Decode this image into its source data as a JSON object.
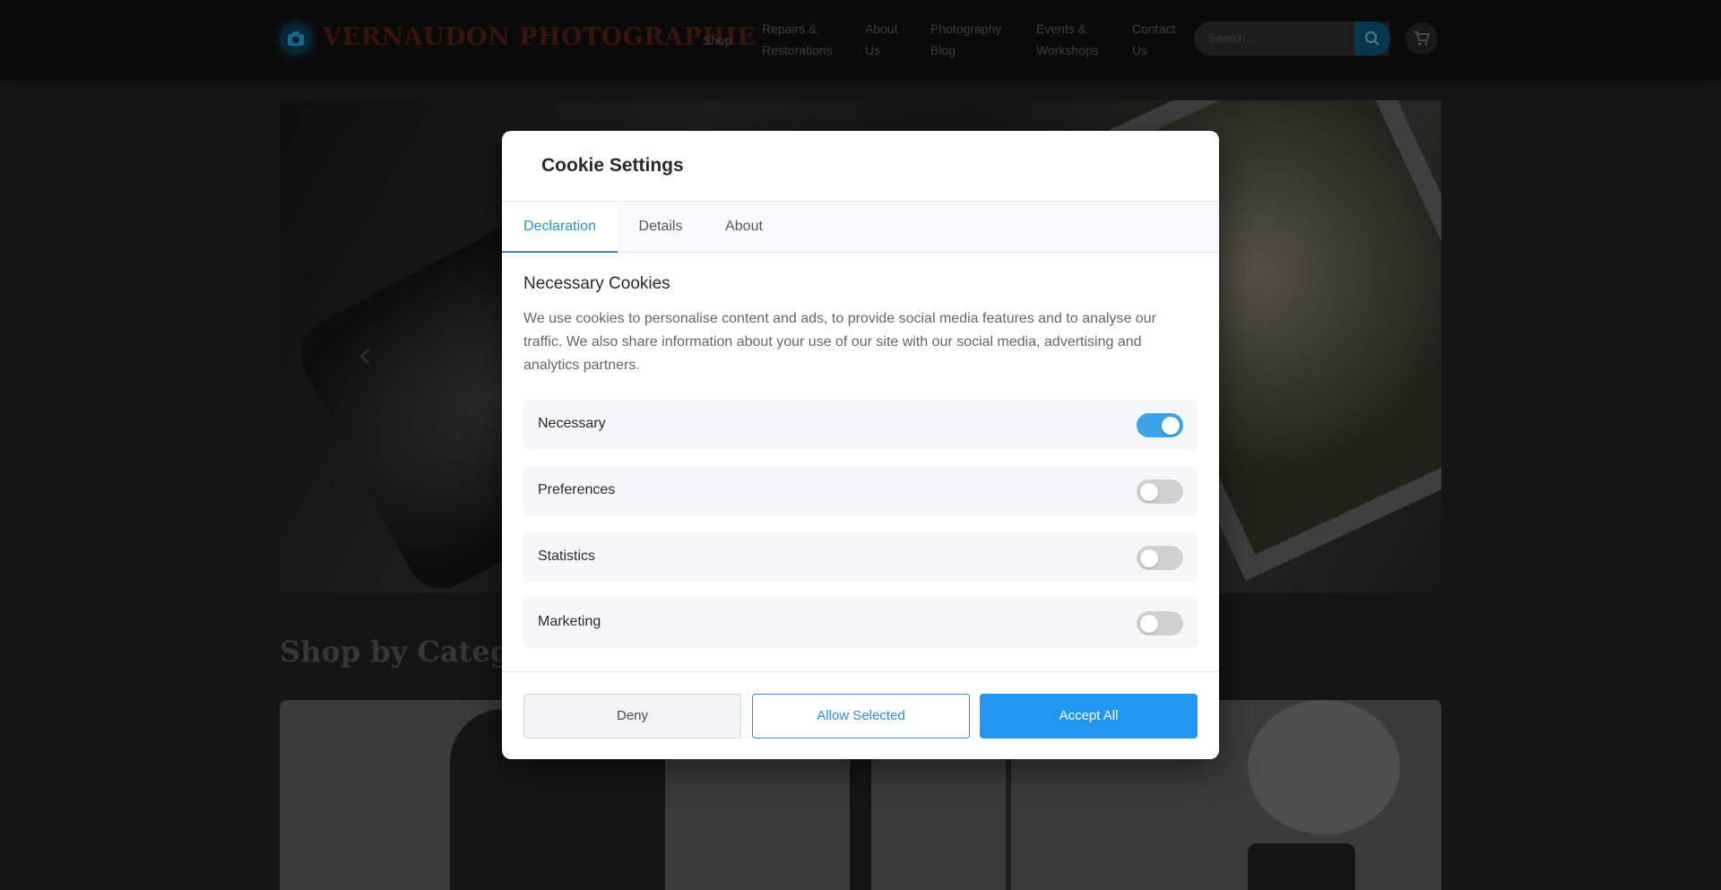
{
  "site": {
    "logo_text": "VERNAUDON PHOTOGRAPHIE",
    "nav": [
      {
        "label": "Shop"
      },
      {
        "label": "Repairs & Restorations"
      },
      {
        "label": "About Us"
      },
      {
        "label": "Photography Blog"
      },
      {
        "label": "Events & Workshops"
      },
      {
        "label": "Contact Us"
      }
    ],
    "search_placeholder": "Search...",
    "hero_prev_arrow": "‹",
    "section_title": "Shop by Category"
  },
  "icons": {
    "logo": "camera-icon",
    "search": "search-icon",
    "cart": "cart-icon"
  },
  "colors": {
    "accent": "#2196f3",
    "tab_active": "#2a8fd6",
    "toggle_on": "#3aa5e8",
    "toggle_off": "#d0d0d0"
  },
  "modal": {
    "title": "Cookie Settings",
    "tabs": [
      {
        "label": "Declaration",
        "active": true
      },
      {
        "label": "Details",
        "active": false
      },
      {
        "label": "About",
        "active": false
      }
    ],
    "heading": "Necessary Cookies",
    "description": "We use cookies to personalise content and ads, to provide social media features and to analyse our traffic. We also share information about your use of our site with our social media, advertising and analytics partners.",
    "toggles": [
      {
        "label": "Necessary",
        "on": true
      },
      {
        "label": "Preferences",
        "on": false
      },
      {
        "label": "Statistics",
        "on": false
      },
      {
        "label": "Marketing",
        "on": false
      }
    ],
    "buttons": {
      "deny": "Deny",
      "allow_selected": "Allow Selected",
      "accept_all": "Accept All"
    }
  }
}
